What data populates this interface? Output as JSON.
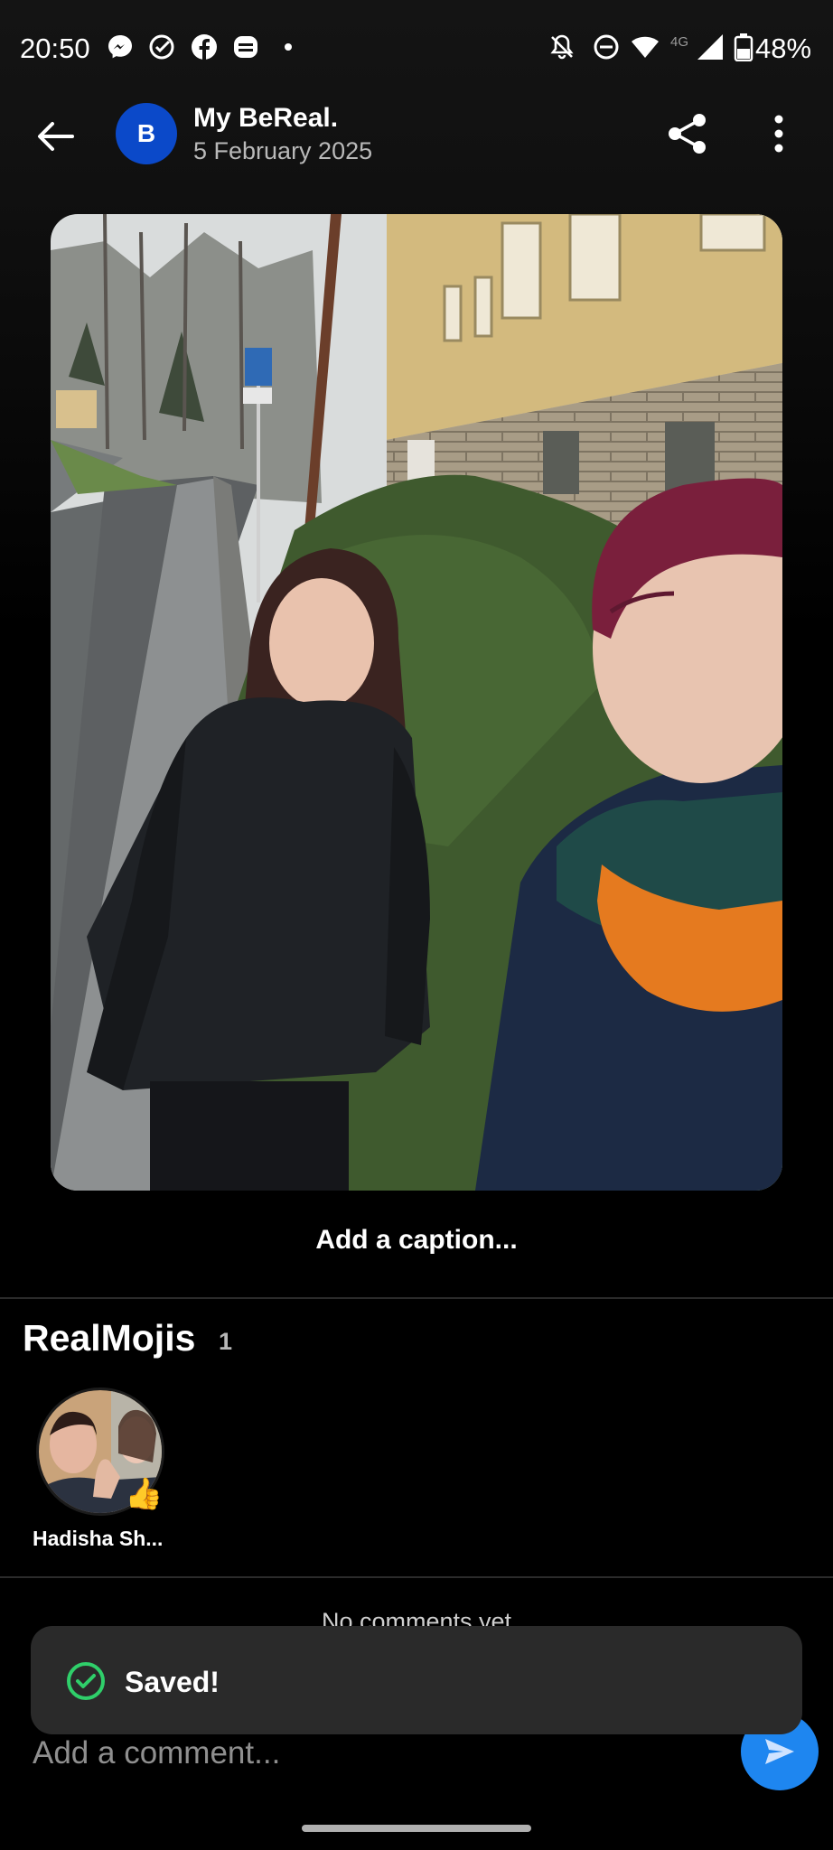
{
  "status_bar": {
    "time": "20:50",
    "network": "4G",
    "battery": "48%",
    "icons": [
      "messenger-icon",
      "check-circle-icon",
      "facebook-icon",
      "bereal-icon",
      "dot-icon",
      "bell-off-icon",
      "dnd-icon",
      "wifi-icon",
      "signal-icon",
      "battery-icon"
    ]
  },
  "header": {
    "avatar_letter": "B",
    "title": "My BeReal.",
    "date": "5 February 2025",
    "accent": "#0b49c9"
  },
  "post": {
    "caption_placeholder": "Add a caption..."
  },
  "realmojis": {
    "title": "RealMojis",
    "count": "1",
    "items": [
      {
        "name": "Hadisha Sh...",
        "emoji": "👍"
      }
    ]
  },
  "comments": {
    "empty_text": "No comments yet",
    "input_placeholder": "Add a comment...",
    "send_color": "#1e86f0"
  },
  "toast": {
    "message": "Saved!",
    "icon_color": "#2fcf6a"
  }
}
